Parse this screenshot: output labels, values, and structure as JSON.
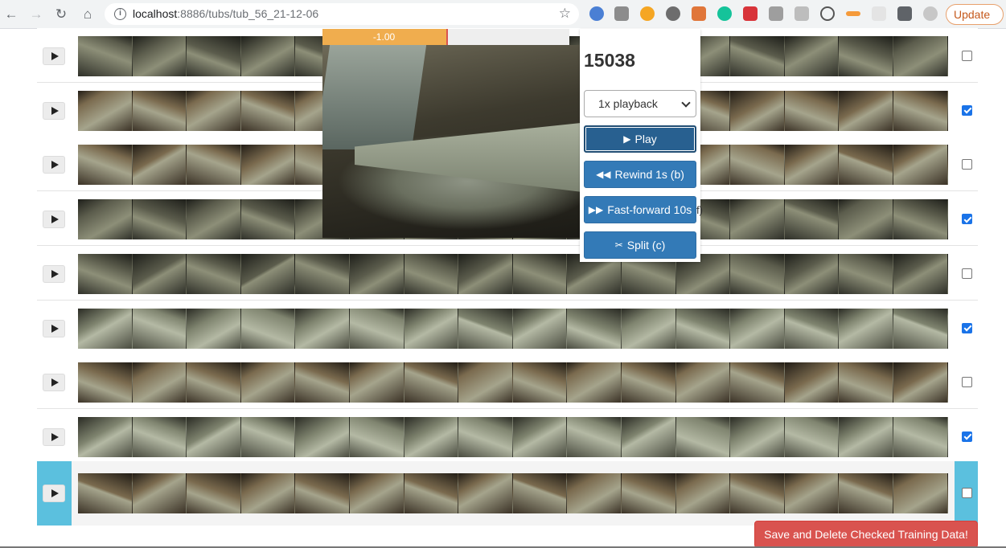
{
  "browser": {
    "url_host": "localhost",
    "url_rest": ":8886/tubs/tub_56_21-12-06",
    "update_label": "Update"
  },
  "rows": [
    {
      "checked": false,
      "tone": "dark"
    },
    {
      "checked": true,
      "tone": "warm"
    },
    {
      "checked": false,
      "tone": "warm"
    },
    {
      "checked": true,
      "tone": "dark"
    },
    {
      "checked": false,
      "tone": "dark"
    },
    {
      "checked": true,
      "tone": "pale"
    },
    {
      "checked": false,
      "tone": "warm"
    },
    {
      "checked": true,
      "tone": "pale"
    },
    {
      "checked": false,
      "tone": "warm",
      "active": true
    }
  ],
  "player": {
    "timeline_label": "-1.00",
    "timeline_position": 0.5,
    "frame_counter": "15038",
    "speed_option": "1x playback",
    "play_label": "Play",
    "rewind_label": "Rewind 1s (b)",
    "fastforward_label": "Fast-forward 10s",
    "split_label": "Split (c)",
    "stray_text": "f)"
  },
  "save_label": "Save and Delete Checked Training Data!",
  "colors": {
    "primary": "#337ab7",
    "danger": "#d9534f",
    "active_row": "#5bc0de",
    "timeline": "#f0ad4e"
  }
}
